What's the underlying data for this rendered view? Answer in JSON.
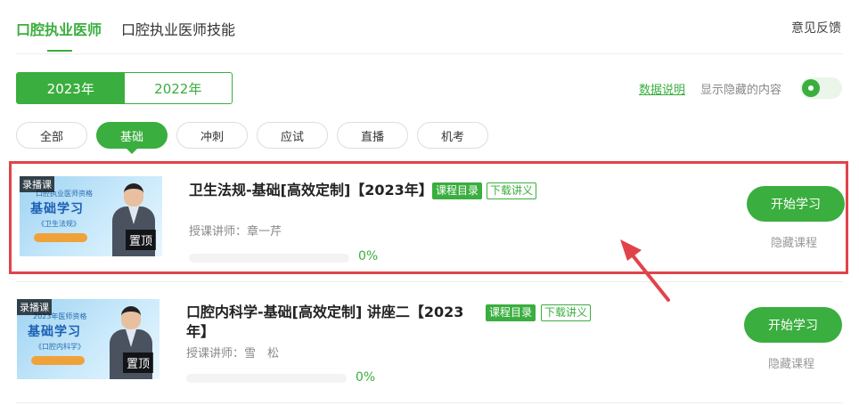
{
  "top_tabs": [
    "口腔执业医师",
    "口腔执业医师技能"
  ],
  "feedback": "意见反馈",
  "years": [
    "2023年",
    "2022年"
  ],
  "data_note": "数据说明",
  "show_hidden_label": "显示隐藏的内容",
  "show_hidden_on": true,
  "filters": [
    "全部",
    "基础",
    "冲刺",
    "应试",
    "直播",
    "机考"
  ],
  "active_filter": "基础",
  "accent_color": "#3aae3e",
  "highlight_color": "#e0444a",
  "courses": [
    {
      "tag": "录播课",
      "thumb_exam": "口腔执业医师资格",
      "thumb_title": "基础学习",
      "thumb_subject": "《卫生法规》",
      "pin": "置顶",
      "title": "卫生法规-基础[高效定制]【2023年】",
      "catalog": "课程目录",
      "download": "下载讲义",
      "teacher_label": "授课讲师：",
      "teacher": "章一芹",
      "progress": "0%",
      "start": "开始学习",
      "hide": "隐藏课程"
    },
    {
      "tag": "录播课",
      "thumb_exam": "2023年医师资格",
      "thumb_title": "基础学习",
      "thumb_subject": "《口腔内科学》",
      "pin": "置顶",
      "title": "口腔内科学-基础[高效定制] 讲座二【2023年】",
      "catalog": "课程目录",
      "download": "下载讲义",
      "teacher_label": "授课讲师：",
      "teacher": "雪　松",
      "progress": "0%",
      "start": "开始学习",
      "hide": "隐藏课程"
    }
  ]
}
